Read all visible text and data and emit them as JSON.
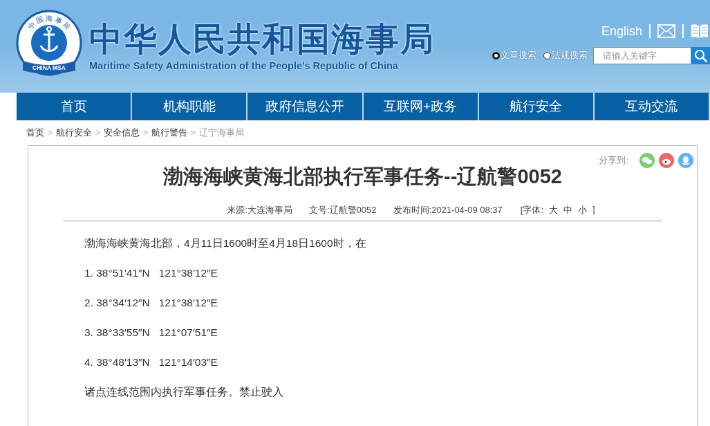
{
  "header": {
    "logo": {
      "ring_text": "中国海事局",
      "bottom_text": "CHINA MSA"
    },
    "title": "中华人民共和国海事局",
    "subtitle": "Maritime Safety Administration of the People’s Republic of China",
    "language_link": "English",
    "search_scopes": [
      {
        "label": "文章搜索",
        "selected": true
      },
      {
        "label": "法规搜索",
        "selected": false
      }
    ],
    "search": {
      "placeholder": "请输入关键字"
    }
  },
  "nav": [
    {
      "label": "首页"
    },
    {
      "label": "机构职能"
    },
    {
      "label": "政府信息公开"
    },
    {
      "label": "互联网+政务"
    },
    {
      "label": "航行安全"
    },
    {
      "label": "互动交流"
    }
  ],
  "breadcrumb": [
    {
      "label": "首页",
      "current": false
    },
    {
      "separator": ">",
      "label": "航行安全",
      "current": false
    },
    {
      "separator": ">",
      "label": "安全信息",
      "current": false
    },
    {
      "separator": ">",
      "label": "航行警告",
      "current": false
    },
    {
      "separator": ">",
      "label": "辽宁海事局",
      "current": true
    }
  ],
  "article": {
    "share_label": "分享到:",
    "share": [
      {
        "kind": "wechat",
        "color": "#7ccd6c"
      },
      {
        "kind": "weibo",
        "color": "#e8696a"
      },
      {
        "kind": "qq",
        "color": "#5eb2ef"
      }
    ],
    "title": "渤海海峡黄海北部执行军事任务--辽航警0052",
    "meta": [
      {
        "label": "来源:",
        "value": "大连海事局"
      },
      {
        "label": "文号:",
        "value": "辽航警0052"
      },
      {
        "label": "发布时间:",
        "value": "2021-04-09 08:37"
      }
    ],
    "font_size": {
      "label": "[字体:",
      "options": [
        "大",
        "中",
        "小"
      ],
      "close": "]"
    },
    "paragraphs": [
      "渤海海峡黄海北部，4月11日1600时至4月18日1600时，在",
      "1. 38°51′41″N   121°38′12″E",
      "2. 38°34′12″N   121°38′12″E",
      "3. 38°33′55″N   121°07′51″E",
      "4. 38°48′13″N   121°14′03″E",
      "诸点连线范围内执行军事任务。禁止驶入"
    ]
  }
}
